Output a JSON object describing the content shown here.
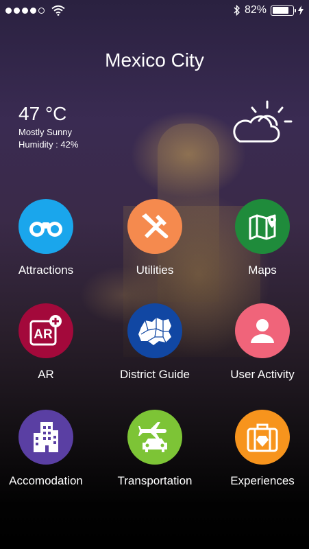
{
  "status_bar": {
    "battery_text": "82%",
    "battery_level": 0.82,
    "signal_bars": 4,
    "signal_total": 5
  },
  "header": {
    "title": "Mexico City"
  },
  "weather": {
    "temperature": "47",
    "unit": "°C",
    "condition": "Mostly Sunny",
    "humidity": "Humidity : 42%",
    "icon": "partly-cloudy-icon"
  },
  "menu": [
    {
      "label": "Attractions",
      "icon": "binoculars-icon",
      "color": "#1AA6EC"
    },
    {
      "label": "Utilities",
      "icon": "tools-icon",
      "color": "#F58A4E"
    },
    {
      "label": "Maps",
      "icon": "map-icon",
      "color": "#1F8B3B"
    },
    {
      "label": "AR",
      "icon": "ar-icon",
      "color": "#A3093B"
    },
    {
      "label": "District Guide",
      "icon": "district-map-icon",
      "color": "#1147A3"
    },
    {
      "label": "User Activity",
      "icon": "user-icon",
      "color": "#F0647A"
    },
    {
      "label": "Accomodation",
      "icon": "building-icon",
      "color": "#5A3FA3"
    },
    {
      "label": "Transportation",
      "icon": "plane-car-icon",
      "color": "#7DC436"
    },
    {
      "label": "Experiences",
      "icon": "suitcase-icon",
      "color": "#F7941D"
    }
  ]
}
